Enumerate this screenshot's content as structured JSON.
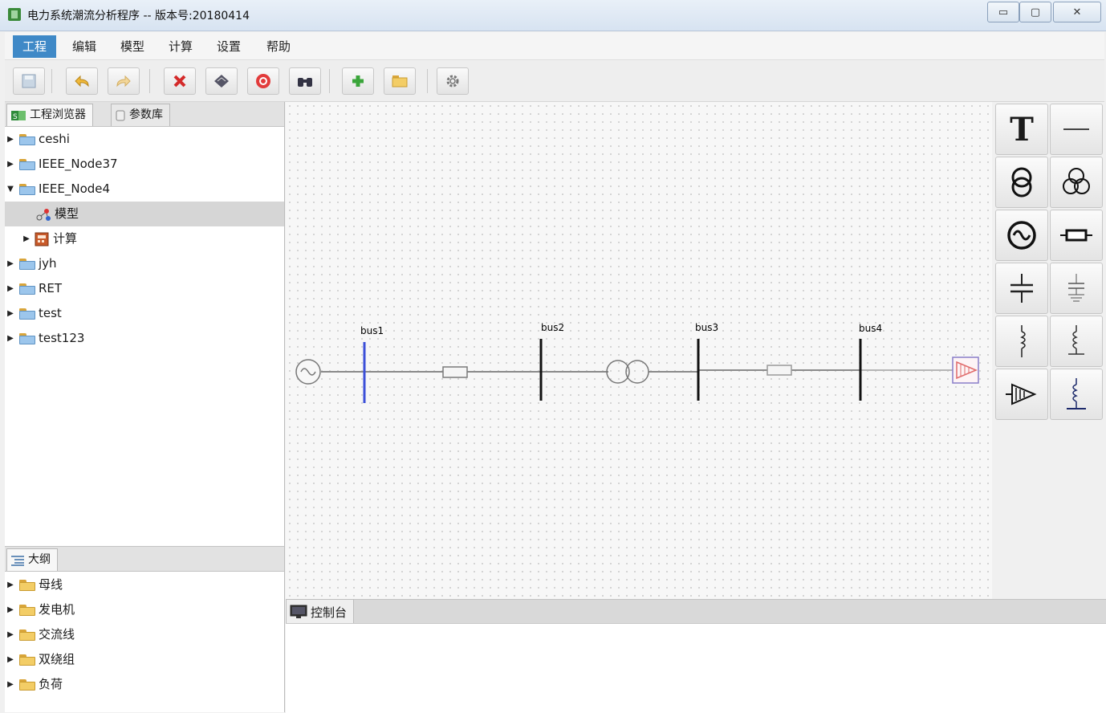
{
  "window": {
    "title": "电力系统潮流分析程序 -- 版本号:20180414"
  },
  "menu": [
    "工程",
    "编辑",
    "模型",
    "计算",
    "设置",
    "帮助"
  ],
  "toolbar": {
    "buttons": [
      {
        "name": "save-button",
        "icon": "save-icon"
      },
      {
        "name": "undo-button",
        "icon": "undo-icon"
      },
      {
        "name": "redo-button",
        "icon": "redo-icon"
      },
      {
        "name": "delete-button",
        "icon": "delete-icon"
      },
      {
        "name": "diamond-button",
        "icon": "diamond-icon"
      },
      {
        "name": "stop-button",
        "icon": "stop-icon"
      },
      {
        "name": "find-button",
        "icon": "binoculars-icon"
      },
      {
        "name": "add-button",
        "icon": "add-icon"
      },
      {
        "name": "open-button",
        "icon": "folder-icon"
      },
      {
        "name": "settings-button",
        "icon": "gear-icon"
      }
    ]
  },
  "explorer": {
    "tabs": [
      "工程浏览器",
      "参数库"
    ],
    "tree": [
      {
        "label": "ceshi",
        "expanded": false,
        "level": 0
      },
      {
        "label": "IEEE_Node37",
        "expanded": false,
        "level": 0
      },
      {
        "label": "IEEE_Node4",
        "expanded": true,
        "level": 0
      },
      {
        "label": "模型",
        "level": 1,
        "selected": true
      },
      {
        "label": "计算",
        "level": 1,
        "expanded": false
      },
      {
        "label": "jyh",
        "expanded": false,
        "level": 0
      },
      {
        "label": "RET",
        "expanded": false,
        "level": 0
      },
      {
        "label": "test",
        "expanded": false,
        "level": 0
      },
      {
        "label": "test123",
        "expanded": false,
        "level": 0
      }
    ]
  },
  "outline": {
    "tab": "大纲",
    "items": [
      "母线",
      "发电机",
      "交流线",
      "双绕组",
      "负荷"
    ]
  },
  "diagram": {
    "buses": [
      "bus1",
      "bus2",
      "bus3",
      "bus4"
    ]
  },
  "palette": {
    "tools": [
      "text-tool",
      "line-tool",
      "two-winding-transformer-tool",
      "three-winding-transformer-tool",
      "generator-tool",
      "ac-line-tool",
      "capacitor-tool",
      "ground-capacitor-tool",
      "inductor-tool",
      "shunt-reactor-tool",
      "load-tool",
      "grounded-reactor-tool"
    ],
    "text_tool_label": "T"
  },
  "console": {
    "tab": "控制台"
  }
}
